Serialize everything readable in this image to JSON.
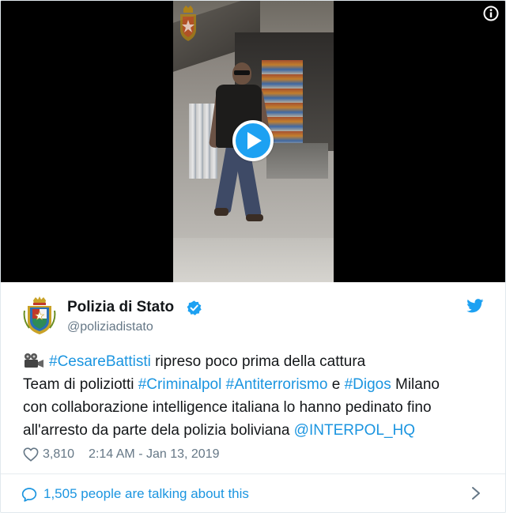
{
  "colors": {
    "link": "#1b95e0",
    "secondary_text": "#657786",
    "primary_text": "#14171a",
    "play_button": "#1da1f2",
    "video_background": "#000000"
  },
  "media": {
    "play_icon": "play-icon",
    "info_icon": "info-icon"
  },
  "author": {
    "name": "Polizia di Stato",
    "handle": "@poliziadistato",
    "verified_icon": "verified-badge-icon",
    "brand_icon": "twitter-bird-icon"
  },
  "tweet": {
    "line1": {
      "emoji": "movie-camera-icon",
      "hashtag1": "#CesareBattisti",
      "text1": " ripreso poco prima della cattura"
    },
    "line2": {
      "text1": "Team di poliziotti ",
      "hashtag1": "#Criminalpol",
      "text2": " ",
      "hashtag2": "#Antiterrorismo",
      "text3": " e ",
      "hashtag3": "#Digos",
      "text4": " Milano"
    },
    "line3": {
      "text1": "con collaborazione intelligence italiana lo hanno pedinato fino"
    },
    "line4": {
      "text1": "all'arresto da parte dela polizia boliviana ",
      "mention1": "@INTERPOL_HQ"
    }
  },
  "meta": {
    "likes": "3,810",
    "timestamp": "2:14 AM - Jan 13, 2019"
  },
  "footer": {
    "talking_text": "1,505 people are talking about this"
  }
}
